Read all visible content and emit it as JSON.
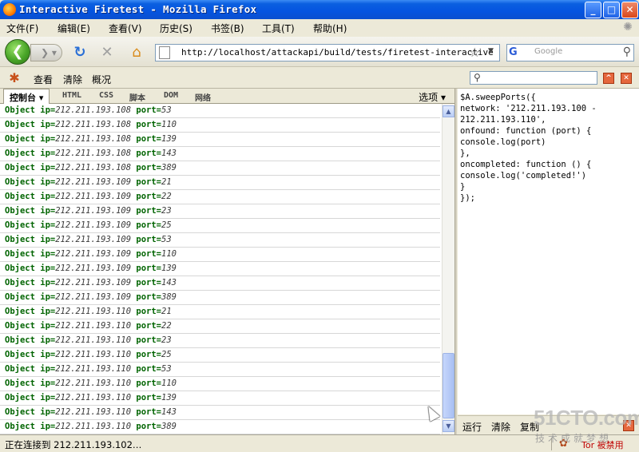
{
  "window": {
    "title": "Interactive Firetest - Mozilla Firefox",
    "buttons": {
      "minimize": "_",
      "maximize": "□",
      "close": "✕"
    }
  },
  "menu": [
    "文件(F)",
    "编辑(E)",
    "查看(V)",
    "历史(S)",
    "书签(B)",
    "工具(T)",
    "帮助(H)"
  ],
  "nav": {
    "url": "http://localhost/attackapi/build/tests/firetest-interactive",
    "search_engine": "G",
    "search_placeholder": "Google"
  },
  "firebug": {
    "toolbar": [
      "查看",
      "清除",
      "概况"
    ],
    "tabs": [
      "控制台 ▾",
      "HTML",
      "CSS",
      "脚本",
      "DOM",
      "网络"
    ],
    "options": "选项 ▾"
  },
  "console": {
    "key_object": "Object",
    "key_ip": "ip=",
    "key_port": "port=",
    "rows": [
      {
        "ip": "212.211.193.108",
        "port": "53"
      },
      {
        "ip": "212.211.193.108",
        "port": "110"
      },
      {
        "ip": "212.211.193.108",
        "port": "139"
      },
      {
        "ip": "212.211.193.108",
        "port": "143"
      },
      {
        "ip": "212.211.193.108",
        "port": "389"
      },
      {
        "ip": "212.211.193.109",
        "port": "21"
      },
      {
        "ip": "212.211.193.109",
        "port": "22"
      },
      {
        "ip": "212.211.193.109",
        "port": "23"
      },
      {
        "ip": "212.211.193.109",
        "port": "25"
      },
      {
        "ip": "212.211.193.109",
        "port": "53"
      },
      {
        "ip": "212.211.193.109",
        "port": "110"
      },
      {
        "ip": "212.211.193.109",
        "port": "139"
      },
      {
        "ip": "212.211.193.109",
        "port": "143"
      },
      {
        "ip": "212.211.193.109",
        "port": "389"
      },
      {
        "ip": "212.211.193.110",
        "port": "21"
      },
      {
        "ip": "212.211.193.110",
        "port": "22"
      },
      {
        "ip": "212.211.193.110",
        "port": "23"
      },
      {
        "ip": "212.211.193.110",
        "port": "25"
      },
      {
        "ip": "212.211.193.110",
        "port": "53"
      },
      {
        "ip": "212.211.193.110",
        "port": "110"
      },
      {
        "ip": "212.211.193.110",
        "port": "139"
      },
      {
        "ip": "212.211.193.110",
        "port": "143"
      },
      {
        "ip": "212.211.193.110",
        "port": "389"
      }
    ]
  },
  "editor": {
    "code": [
      "$A.sweepPorts({",
      "network: '212.211.193.100 -",
      "212.211.193.110',",
      "onfound: function (port) {",
      "console.log(port)",
      "},",
      "oncompleted: function () {",
      "console.log('completed!')",
      "}",
      "});"
    ],
    "buttons": [
      "运行",
      "清除",
      "复制"
    ]
  },
  "status": {
    "text": "正在连接到 212.211.193.102…",
    "tor": "Tor 被禁用"
  },
  "watermark": {
    "logo": "51CTO.com",
    "sub": "技术成就梦想"
  }
}
